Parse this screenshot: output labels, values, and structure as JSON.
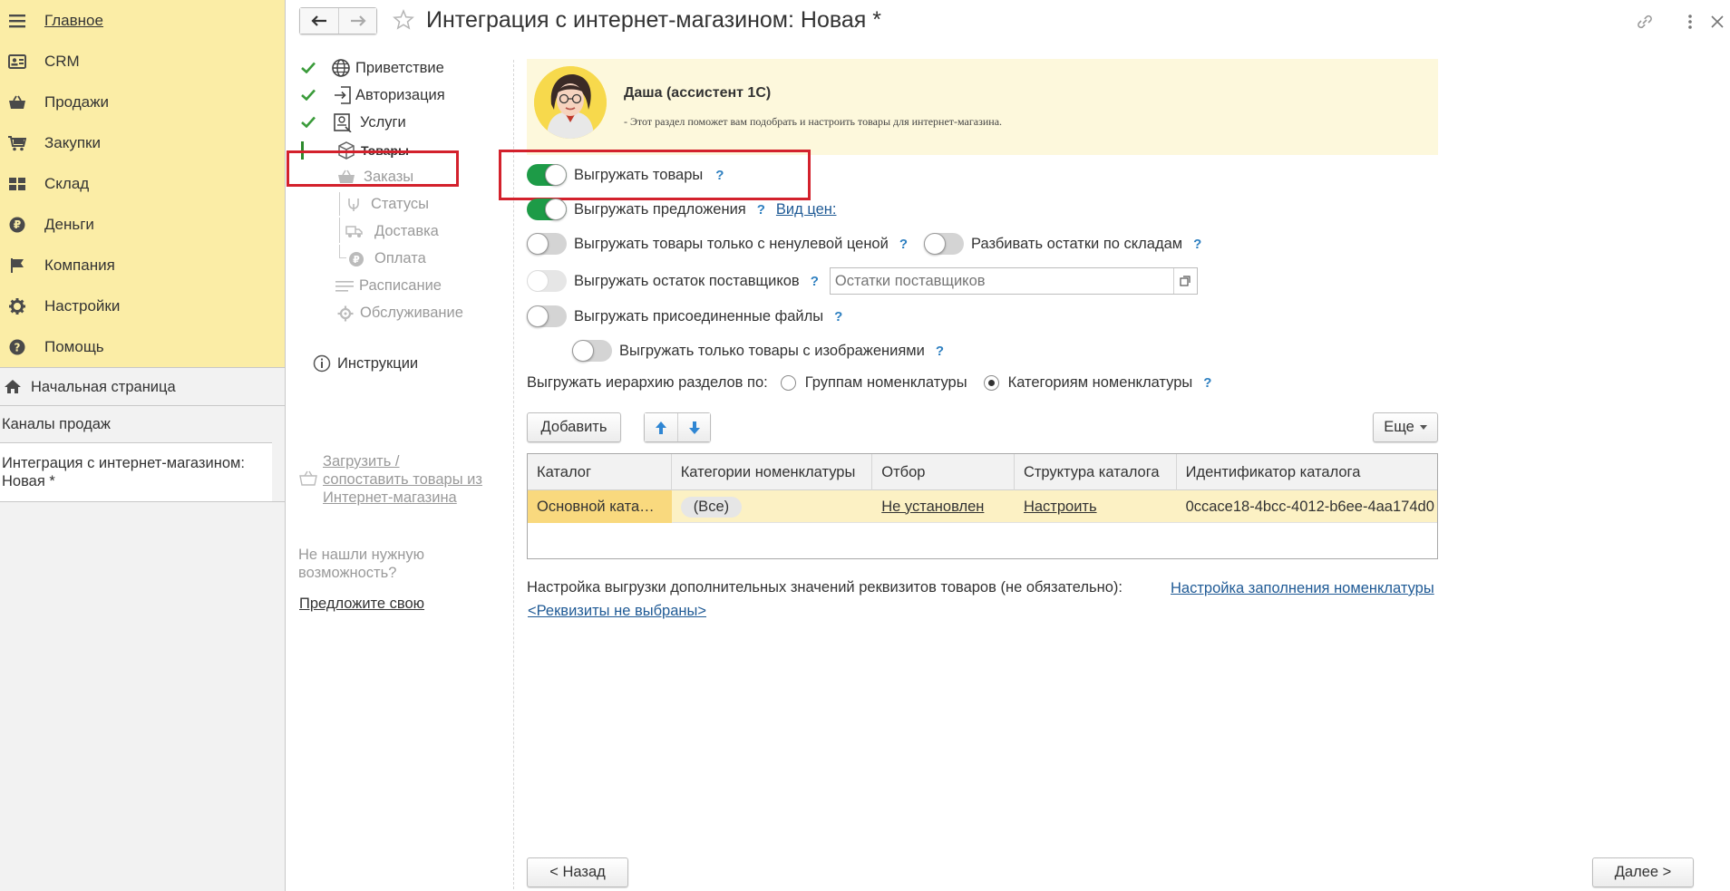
{
  "sidebar": {
    "items": [
      {
        "label": "Главное",
        "icon": "menu-icon"
      },
      {
        "label": "CRM",
        "icon": "id-card-icon"
      },
      {
        "label": "Продажи",
        "icon": "basket-icon"
      },
      {
        "label": "Закупки",
        "icon": "cart-icon"
      },
      {
        "label": "Склад",
        "icon": "grid-icon"
      },
      {
        "label": "Деньги",
        "icon": "ruble-coin-icon"
      },
      {
        "label": "Компания",
        "icon": "flag-icon"
      },
      {
        "label": "Настройки",
        "icon": "gear-icon"
      },
      {
        "label": "Помощь",
        "icon": "help-icon"
      }
    ],
    "open_windows": {
      "home": "Начальная страница",
      "channels": "Каналы продаж",
      "current": "Интеграция с интернет-магазином: Новая *"
    }
  },
  "header": {
    "title": "Интеграция с интернет-магазином: Новая *"
  },
  "steps": {
    "welcome": "Приветствие",
    "auth": "Авторизация",
    "services": "Услуги",
    "goods": "Товары",
    "orders": "Заказы",
    "statuses": "Статусы",
    "delivery": "Доставка",
    "payment": "Оплата",
    "schedule": "Расписание",
    "maintenance": "Обслуживание",
    "instructions": "Инструкции",
    "load_link": "Загрузить / сопоставить товары из Интернет-магазина",
    "not_found": "Не нашли нужную возможность?",
    "suggest": "Предложите свою"
  },
  "assistant": {
    "name": "Даша (ассистент 1С)",
    "text": "- Этот раздел поможет вам подобрать и настроить товары для интернет-магазина."
  },
  "options": {
    "export_goods": "Выгружать товары",
    "export_offers": "Выгружать предложения",
    "price_type": "Вид цен:",
    "nonzero_price": "Выгружать товары только с ненулевой ценой",
    "split_stock": "Разбивать остатки по складам",
    "supplier_stock": "Выгружать остаток поставщиков",
    "supplier_placeholder": "Остатки поставщиков",
    "attached_files": "Выгружать присоединенные файлы",
    "only_images": "Выгружать только товары с изображениями",
    "hierarchy_label": "Выгружать иерархию разделов по:",
    "hierarchy_groups": "Группам номенклатуры",
    "hierarchy_categories": "Категориям номенклатуры",
    "help": "?"
  },
  "toolbar": {
    "add": "Добавить",
    "more": "Еще"
  },
  "table": {
    "columns": [
      "Каталог",
      "Категории номенклатуры",
      "Отбор",
      "Структура каталога",
      "Идентификатор каталога"
    ],
    "rows": [
      {
        "catalog": "Основной ката…",
        "categories": "(Все)",
        "filter": "Не установлен",
        "structure": "Настроить",
        "id": "0ccace18-4bcc-4012-b6ee-4aa174d0"
      }
    ]
  },
  "extra": {
    "label": "Настройка выгрузки дополнительных значений реквизитов товаров (не обязательно):",
    "fill_link": "Настройка заполнения номенклатуры",
    "attrs_link": "<Реквизиты не выбраны>"
  },
  "footer": {
    "back": "< Назад",
    "next": "Далее >"
  },
  "colors": {
    "nav_bg": "#fbeda6",
    "toggle_on": "#1d9b47",
    "highlight_red": "#d3212c",
    "link": "#1f5a95",
    "help": "#2d7fc0"
  }
}
